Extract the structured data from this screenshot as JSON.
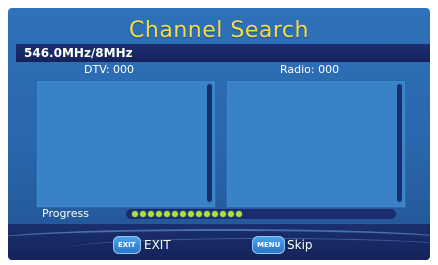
{
  "title": "Channel Search",
  "frequency": "546.0MHz/8MHz",
  "counts": {
    "dtv": "DTV: 000",
    "radio": "Radio: 000"
  },
  "progress": {
    "label": "Progress",
    "filled_dots": 14,
    "fraction": 0.52
  },
  "footer": {
    "exit_key": "EXIT",
    "exit_label": "EXIT",
    "menu_key": "MENU",
    "skip_label": "Skip"
  },
  "colors": {
    "title": "#f2dc4b",
    "background": "#2a66ab",
    "bar": "#1b2f72",
    "progress_dot": "#a6e03a"
  }
}
